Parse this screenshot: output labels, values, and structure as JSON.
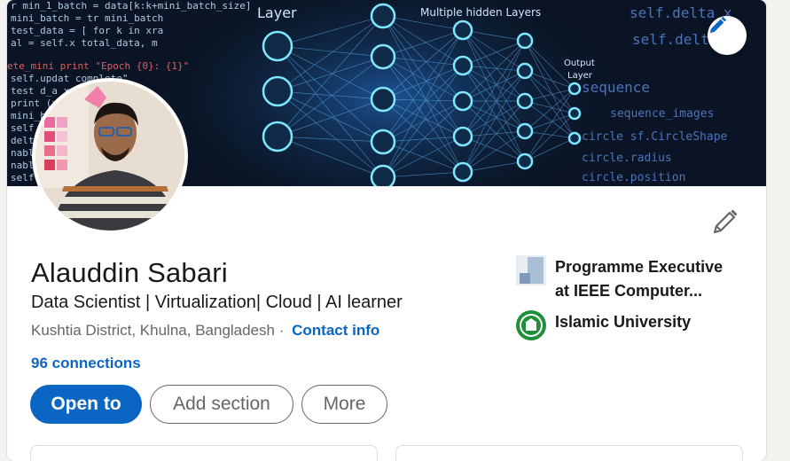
{
  "profile": {
    "name": "Alauddin Sabari",
    "headline": "Data Scientist | Virtualization| Cloud | AI learner",
    "location": "Kushtia District, Khulna, Bangladesh",
    "separator": "·",
    "contact_label": "Contact info",
    "connections": "96 connections"
  },
  "cover": {
    "labels": {
      "layer": "Layer",
      "hidden_layers": "Multiple hidden Layers",
      "output_layer_1": "Output",
      "output_layer_2": "Layer"
    },
    "code_right": [
      "self.delta_x",
      "self.delta_y",
      "sequence",
      "sequence_images",
      "circle sf.CircleShape",
      "circle.radius",
      "circle.position"
    ]
  },
  "actions": {
    "open_to": "Open to",
    "add_section": "Add section",
    "more": "More"
  },
  "sidebar": {
    "items": [
      {
        "label_line1": "Programme Executive",
        "label_line2": "at IEEE Computer...",
        "icon": "company-logo-icon"
      },
      {
        "label_line1": "Islamic University",
        "icon": "university-logo-icon"
      }
    ]
  },
  "colors": {
    "primary": "#0a66c2",
    "text": "#191919",
    "muted": "#666666",
    "cover_bg": "#0a1424",
    "node": "#7fe6ff"
  }
}
